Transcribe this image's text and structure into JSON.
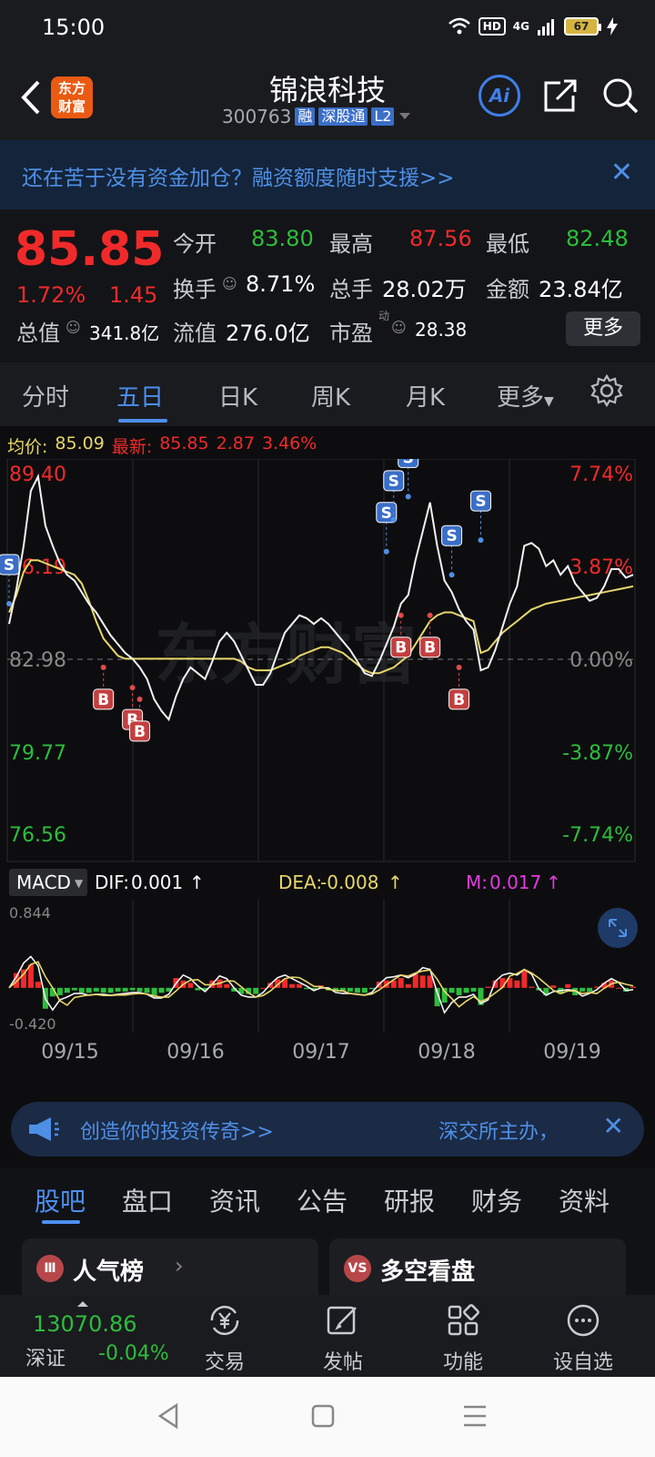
{
  "status": {
    "time": "15:00",
    "hd": "HD",
    "net": "4G",
    "battery": "67"
  },
  "header": {
    "logo": "东方\n财富",
    "title": "锦浪科技",
    "code": "300763",
    "tags": [
      "融",
      "深股通",
      "L2"
    ],
    "ai_label": "Ai"
  },
  "banner": {
    "text": "还在苦于没有资金加仓？融资额度随时支援>>"
  },
  "quote": {
    "price": "85.85",
    "pct": "1.72%",
    "chg": "1.45",
    "open_label": "今开",
    "open": "83.80",
    "high_label": "最高",
    "high": "87.56",
    "low_label": "最低",
    "low": "82.48",
    "turnover_label": "换手",
    "turnover": "8.71%",
    "volume_label": "总手",
    "volume": "28.02万",
    "amount_label": "金额",
    "amount": "23.84亿",
    "mcap_label": "总值",
    "mcap": "341.8亿",
    "float_label": "流值",
    "float": "276.0亿",
    "pe_label": "市盈",
    "pe_sup": "动",
    "pe": "28.38",
    "more": "更多"
  },
  "tabs": [
    "分时",
    "五日",
    "日K",
    "周K",
    "月K",
    "更多"
  ],
  "avg": {
    "avg_label": "均价:",
    "avg": "85.09",
    "latest_label": "最新:",
    "latest": "85.85",
    "chg": "2.87",
    "pct": "3.46%"
  },
  "chart_data": {
    "type": "line",
    "title": "",
    "x_labels": [
      "09/15",
      "09/16",
      "09/17",
      "09/18",
      "09/19"
    ],
    "price_axis": [
      "89.40",
      "86.19",
      "82.98",
      "79.77",
      "76.56"
    ],
    "pct_axis": [
      "7.74%",
      "3.87%",
      "0.00%",
      "-3.87%",
      "-7.74%"
    ],
    "ylim": [
      76.56,
      89.4
    ],
    "prev_close": 82.98,
    "series": [
      {
        "values": [
          84.2,
          85.4,
          86.9,
          88.8,
          89.3,
          87.6,
          86.9,
          86.3,
          85.9,
          85.7,
          85.3,
          84.9,
          84.6,
          84.2,
          83.8,
          83.5,
          83.2,
          83.0,
          82.7,
          82.3,
          81.6,
          81.2,
          80.9,
          81.7,
          82.3,
          82.7,
          82.5,
          82.3,
          82.9,
          83.6,
          83.9,
          83.6,
          83.1,
          82.6,
          82.1,
          82.1,
          82.5,
          83.2,
          83.9,
          84.2,
          84.5,
          84.4,
          84.2,
          84.4,
          84.2,
          83.9,
          83.6,
          83.3,
          82.9,
          82.5,
          82.4,
          82.9,
          83.5,
          84.1,
          84.9,
          85.2,
          86.4,
          87.4,
          88.4,
          86.9,
          85.7,
          85.3,
          84.7,
          84.3,
          84.0,
          82.6,
          82.7,
          83.3,
          84.1,
          84.9,
          85.5,
          86.9,
          87.0,
          86.8,
          86.2,
          86.4,
          85.9,
          86.2,
          85.6,
          85.3,
          85.0,
          85.1,
          85.5,
          86.1,
          86.1,
          85.8,
          85.9
        ]
      },
      {
        "values": [
          84.6,
          85.2,
          86.0,
          86.4,
          86.4,
          86.3,
          86.2,
          86.1,
          86.0,
          85.9,
          85.6,
          85.0,
          84.3,
          83.7,
          83.4,
          83.1,
          83.0,
          83.0,
          83.0,
          83.0,
          83.0,
          83.0,
          83.0,
          83.0,
          83.0,
          83.0,
          83.0,
          83.0,
          83.0,
          83.0,
          83.0,
          83.0,
          82.9,
          82.7,
          82.6,
          82.6,
          82.6,
          82.7,
          82.8,
          82.9,
          83.1,
          83.2,
          83.3,
          83.4,
          83.4,
          83.3,
          83.2,
          83.0,
          82.8,
          82.6,
          82.5,
          82.5,
          82.6,
          82.7,
          82.9,
          83.1,
          83.5,
          83.9,
          84.3,
          84.5,
          84.6,
          84.6,
          84.5,
          84.4,
          84.3,
          83.2,
          83.3,
          83.6,
          83.9,
          84.1,
          84.3,
          84.5,
          84.7,
          84.8,
          84.9,
          84.95,
          85.0,
          85.05,
          85.1,
          85.15,
          85.2,
          85.25,
          85.3,
          85.35,
          85.4,
          85.45,
          85.5
        ]
      }
    ],
    "signals": [
      {
        "label": "S",
        "idx": 0,
        "v": 84.9
      },
      {
        "label": "B",
        "idx": 13,
        "v": 82.7
      },
      {
        "label": "B",
        "idx": 17,
        "v": 82.0
      },
      {
        "label": "B",
        "idx": 18,
        "v": 81.6
      },
      {
        "label": "S",
        "idx": 52,
        "v": 86.7
      },
      {
        "label": "S",
        "idx": 53,
        "v": 87.8
      },
      {
        "label": "S",
        "idx": 55,
        "v": 88.6
      },
      {
        "label": "B",
        "idx": 54,
        "v": 84.5
      },
      {
        "label": "B",
        "idx": 58,
        "v": 84.5
      },
      {
        "label": "B",
        "idx": 62,
        "v": 82.7
      },
      {
        "label": "S",
        "idx": 61,
        "v": 85.9
      },
      {
        "label": "S",
        "idx": 65,
        "v": 87.1
      }
    ],
    "macd": {
      "indicator": "MACD",
      "dif_label": "DIF:",
      "dif": "0.001",
      "dea_label": "DEA:",
      "dea": "-0.008",
      "m_label": "M:",
      "m": "0.017",
      "ymax": "0.844",
      "ymin": "-0.420",
      "ylim": [
        -0.42,
        0.844
      ]
    }
  },
  "ad": {
    "left": "创造你的投资传奇>>",
    "right": "深交所主办，"
  },
  "feature_tabs": [
    "股吧",
    "盘口",
    "资讯",
    "公告",
    "研报",
    "财务",
    "资料"
  ],
  "cards": [
    {
      "icon": "Ⅲ",
      "label": "人气榜"
    },
    {
      "icon": "VS",
      "label": "多空看盘"
    }
  ],
  "bottom_nav": {
    "index_value": "13070.86",
    "index_name": "深证",
    "index_pct": "-0.04%",
    "items": [
      "交易",
      "发帖",
      "功能",
      "设自选"
    ]
  },
  "colors": {
    "up": "#f02a2a",
    "down": "#2dbd3c",
    "accent": "#4c8ff0",
    "avg": "#e8d76a"
  }
}
